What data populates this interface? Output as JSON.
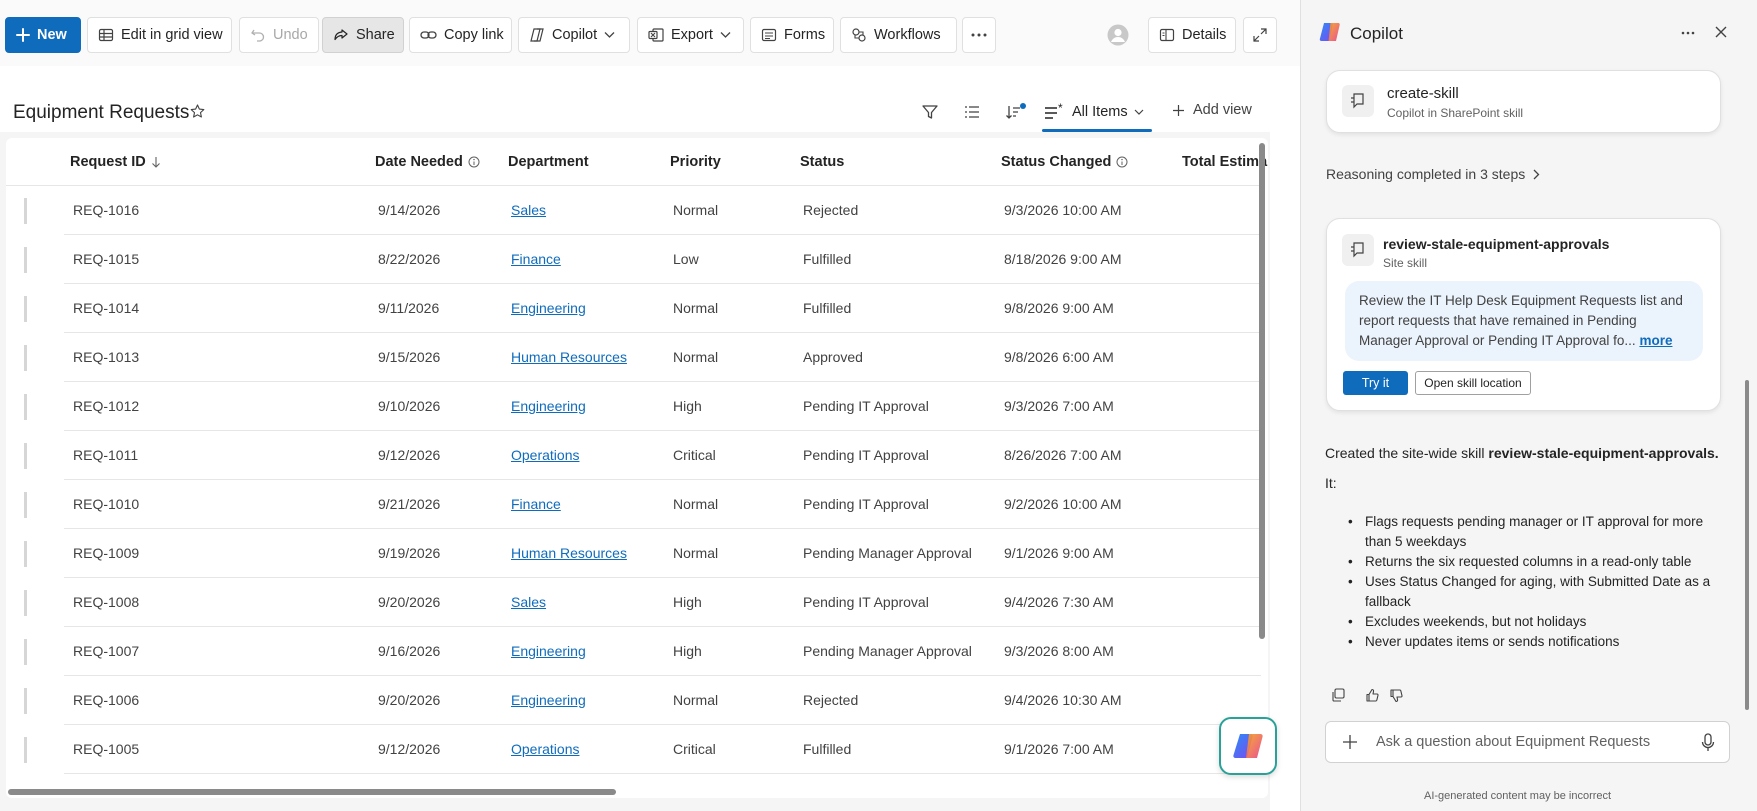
{
  "toolbar": {
    "new_label": "New",
    "edit_grid_label": "Edit in grid view",
    "undo_label": "Undo",
    "share_label": "Share",
    "copy_link_label": "Copy link",
    "copilot_label": "Copilot",
    "export_label": "Export",
    "forms_label": "Forms",
    "workflows_label": "Workflows",
    "details_label": "Details"
  },
  "list": {
    "title": "Equipment Requests",
    "view_name": "All Items",
    "add_view_label": "Add view",
    "columns": {
      "request_id": "Request ID",
      "date_needed": "Date Needed",
      "department": "Department",
      "priority": "Priority",
      "status": "Status",
      "status_changed": "Status Changed",
      "total": "Total Estima"
    },
    "rows": [
      {
        "id": "REQ-1016",
        "date": "9/14/2026",
        "dept": "Sales",
        "priority": "Normal",
        "status": "Rejected",
        "changed": "9/3/2026 10:00 AM"
      },
      {
        "id": "REQ-1015",
        "date": "8/22/2026",
        "dept": "Finance",
        "priority": "Low",
        "status": "Fulfilled",
        "changed": "8/18/2026 9:00 AM"
      },
      {
        "id": "REQ-1014",
        "date": "9/11/2026",
        "dept": "Engineering",
        "priority": "Normal",
        "status": "Fulfilled",
        "changed": "9/8/2026 9:00 AM"
      },
      {
        "id": "REQ-1013",
        "date": "9/15/2026",
        "dept": "Human Resources",
        "priority": "Normal",
        "status": "Approved",
        "changed": "9/8/2026 6:00 AM"
      },
      {
        "id": "REQ-1012",
        "date": "9/10/2026",
        "dept": "Engineering",
        "priority": "High",
        "status": "Pending IT Approval",
        "changed": "9/3/2026 7:00 AM"
      },
      {
        "id": "REQ-1011",
        "date": "9/12/2026",
        "dept": "Operations",
        "priority": "Critical",
        "status": "Pending IT Approval",
        "changed": "8/26/2026 7:00 AM"
      },
      {
        "id": "REQ-1010",
        "date": "9/21/2026",
        "dept": "Finance",
        "priority": "Normal",
        "status": "Pending IT Approval",
        "changed": "9/2/2026 10:00 AM"
      },
      {
        "id": "REQ-1009",
        "date": "9/19/2026",
        "dept": "Human Resources",
        "priority": "Normal",
        "status": "Pending Manager Approval",
        "changed": "9/1/2026 9:00 AM"
      },
      {
        "id": "REQ-1008",
        "date": "9/20/2026",
        "dept": "Sales",
        "priority": "High",
        "status": "Pending IT Approval",
        "changed": "9/4/2026 7:30 AM"
      },
      {
        "id": "REQ-1007",
        "date": "9/16/2026",
        "dept": "Engineering",
        "priority": "High",
        "status": "Pending Manager Approval",
        "changed": "9/3/2026 8:00 AM"
      },
      {
        "id": "REQ-1006",
        "date": "9/20/2026",
        "dept": "Engineering",
        "priority": "Normal",
        "status": "Rejected",
        "changed": "9/4/2026 10:30 AM"
      },
      {
        "id": "REQ-1005",
        "date": "9/12/2026",
        "dept": "Operations",
        "priority": "Critical",
        "status": "Fulfilled",
        "changed": "9/1/2026 7:00 AM"
      }
    ]
  },
  "copilot": {
    "title": "Copilot",
    "skill_card": {
      "title": "create-skill",
      "subtitle": "Copilot in SharePoint skill"
    },
    "reasoning_label": "Reasoning completed in 3 steps",
    "site_skill": {
      "title": "review-stale-equipment-approvals",
      "subtitle": "Site skill",
      "description": "Review the IT Help Desk Equipment Requests list and report requests that have remained in Pending Manager Approval or Pending IT Approval fo...",
      "more_label": "more",
      "try_label": "Try it",
      "open_label": "Open skill location"
    },
    "response_prefix": "Created the site-wide skill ",
    "response_skill": "review-stale-equipment-approvals.",
    "it_label": "It:",
    "bullets": [
      "Flags requests pending manager or IT approval for more than 5 weekdays",
      "Returns the six requested columns in a read-only table",
      "Uses Status Changed for aging, with Submitted Date as a fallback",
      "Excludes weekends, but not holidays",
      "Never updates items or sends notifications"
    ],
    "ask_placeholder": "Ask a question about Equipment Requests",
    "disclaimer": "AI-generated content may be incorrect"
  },
  "colors": {
    "accent": "#0f6cbd",
    "pane_bg": "#f5f5f5",
    "desc_bg": "#ebf3fc"
  }
}
